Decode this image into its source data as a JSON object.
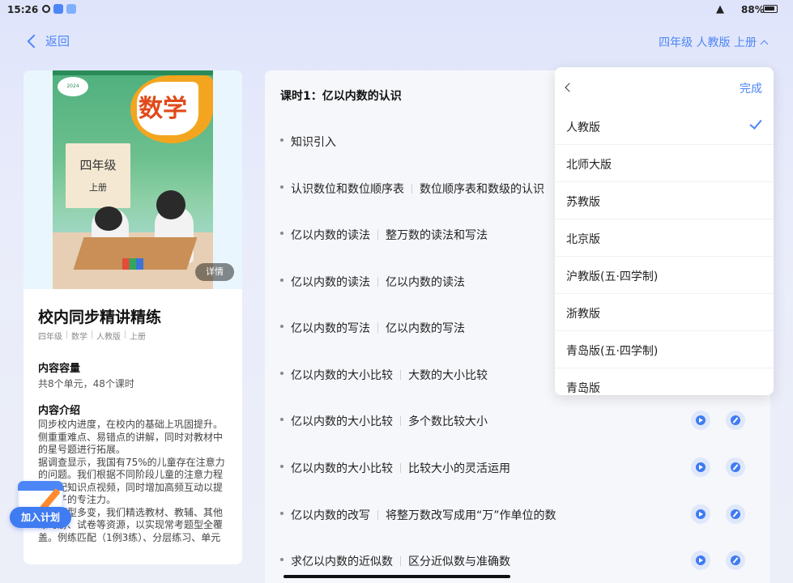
{
  "status_bar": {
    "time": "15:26",
    "battery": "88%"
  },
  "header": {
    "back_label": "返回",
    "edition_label": "四年级 人教版 上册"
  },
  "book": {
    "cover_subject": "数学",
    "cover_grade": "四年级",
    "cover_volume": "上册",
    "cover_publisher_mark": "2024",
    "detail_label": "详情",
    "title": "校内同步精讲精练",
    "tags": [
      "四年级",
      "数学",
      "人教版",
      "上册"
    ],
    "capacity_heading": "内容容量",
    "capacity_text": "共8个单元，48个课时",
    "intro_heading": "内容介绍",
    "intro_paragraphs": [
      "同步校内进度，在校内的基础上巩固提升。侧重重难点、易错点的讲解，同时对教材中的星号题进行拓展。",
      "据调查显示，我国有75%的儿童存在注意力的问题。我们根据不同阶段儿童的注意力程度匹配知识点视频，同时增加高频互动以提升孩子的专注力。",
      "练习题型多变，我们精选教材、教辅、其他练习册、试卷等资源，以实现常考题型全覆盖。例练匹配（1例3练）、分层练习、单元测试卷用于检验孩子的学习"
    ]
  },
  "add_plan": {
    "label": "加入计划"
  },
  "lesson": {
    "title": "课时1：亿以内数的认识",
    "items": [
      {
        "topic": "知识引入",
        "sub": ""
      },
      {
        "topic": "认识数位和数位顺序表",
        "sub": "数位顺序表和数级的认识"
      },
      {
        "topic": "亿以内数的读法",
        "sub": "整万数的读法和写法"
      },
      {
        "topic": "亿以内数的读法",
        "sub": "亿以内数的读法"
      },
      {
        "topic": "亿以内数的写法",
        "sub": "亿以内数的写法"
      },
      {
        "topic": "亿以内数的大小比较",
        "sub": "大数的大小比较"
      },
      {
        "topic": "亿以内数的大小比较",
        "sub": "多个数比较大小"
      },
      {
        "topic": "亿以内数的大小比较",
        "sub": "比较大小的灵活运用"
      },
      {
        "topic": "亿以内数的改写",
        "sub": "将整万数改写成用“万”作单位的数"
      },
      {
        "topic": "求亿以内数的近似数",
        "sub": "区分近似数与准确数"
      }
    ]
  },
  "edition_picker": {
    "done_label": "完成",
    "selected": "人教版",
    "options": [
      "人教版",
      "北师大版",
      "苏教版",
      "北京版",
      "沪教版(五·四学制)",
      "浙教版",
      "青岛版(五·四学制)",
      "青岛版"
    ]
  },
  "colors": {
    "accent": "#4d86f7",
    "plan_button": "#3f7bf1"
  }
}
